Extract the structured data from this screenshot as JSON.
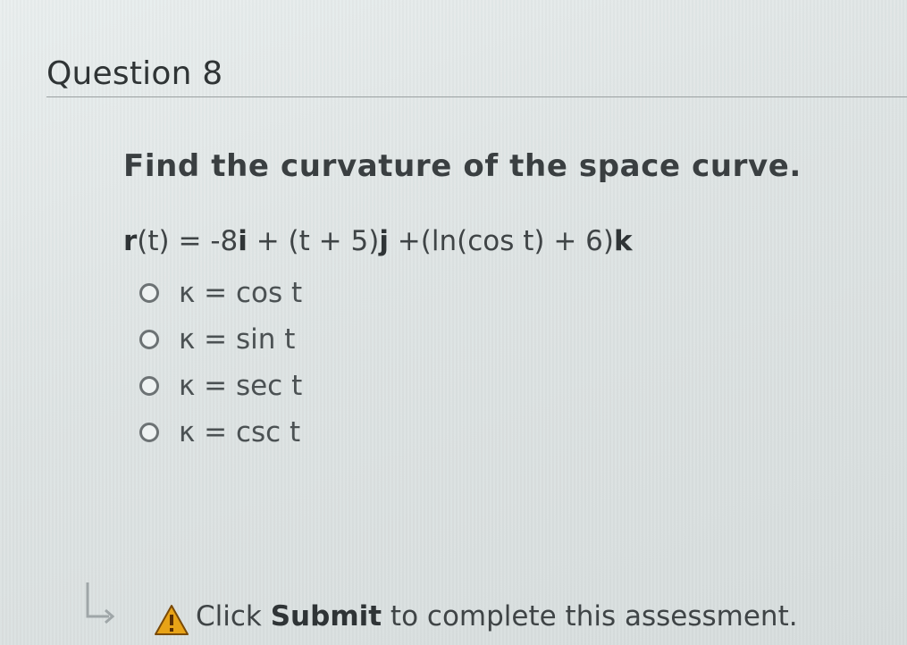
{
  "question": {
    "title": "Question 8",
    "prompt": "Find the curvature of the space curve."
  },
  "equation": {
    "r": "r",
    "part1": "(t) = -8",
    "i": "i",
    "part2": " + (t + 5)",
    "j": "j",
    "part3": " +(ln(cos t) + 6)",
    "k": "k"
  },
  "options": [
    {
      "label": "κ = cos t"
    },
    {
      "label": "κ = sin t"
    },
    {
      "label": "κ = sec t"
    },
    {
      "label": "κ = csc t"
    }
  ],
  "footer": {
    "text_before": "Click ",
    "submit_word": "Submit",
    "text_after": " to complete this assessment.",
    "icons": [
      "return-arrow-icon",
      "warning-icon"
    ],
    "warning_color": "#e8a317"
  }
}
